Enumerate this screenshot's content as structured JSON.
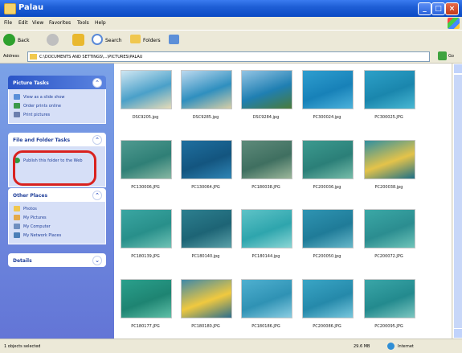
{
  "window": {
    "title": "Palau"
  },
  "menu": [
    "File",
    "Edit",
    "View",
    "Favorites",
    "Tools",
    "Help"
  ],
  "toolbar": {
    "back": "Back",
    "search": "Search",
    "folders": "Folders"
  },
  "address": {
    "label": "Address",
    "path": "C:\\DOCUMENTS AND SETTINGS\\...\\PICTURES\\PALAU",
    "go": "Go"
  },
  "sidebar": {
    "picture_tasks": {
      "title": "Picture Tasks",
      "items": [
        "View as a slide show",
        "Order prints online",
        "Print pictures"
      ]
    },
    "file_folder_tasks": {
      "title": "File and Folder Tasks",
      "items": [
        "Publish this folder to the Web"
      ]
    },
    "other_places": {
      "title": "Other Places",
      "items": [
        "Photos",
        "My Pictures",
        "My Computer",
        "My Network Places"
      ]
    },
    "details": {
      "title": "Details"
    }
  },
  "files": [
    {
      "name": "DSC9205.jpg",
      "colors": [
        "#cfe6f2",
        "#4aa0c9",
        "#e7dcb8"
      ]
    },
    {
      "name": "DSC9285.jpg",
      "colors": [
        "#bcd9ef",
        "#2f8fbf",
        "#d8cfa7"
      ]
    },
    {
      "name": "DSC9284.jpg",
      "colors": [
        "#93c4e4",
        "#1f7fb2",
        "#4a7b3a"
      ]
    },
    {
      "name": "PC300024.jpg",
      "colors": [
        "#2f9ecf",
        "#1781b8",
        "#4cb2db"
      ]
    },
    {
      "name": "PC300025.JPG",
      "colors": [
        "#2da0c8",
        "#1a86ad",
        "#49b8d3"
      ]
    },
    {
      "name": "PC130006.JPG",
      "colors": [
        "#4f9a90",
        "#2f7f76",
        "#87b7a3"
      ]
    },
    {
      "name": "PC130064.JPG",
      "colors": [
        "#1f6f9f",
        "#13557f",
        "#2f85b5"
      ]
    },
    {
      "name": "PC180038.JPG",
      "colors": [
        "#5e8a7a",
        "#3f6f60",
        "#9cb79b"
      ]
    },
    {
      "name": "PC200036.jpg",
      "colors": [
        "#3c9a8f",
        "#2b7f78",
        "#77bca9"
      ]
    },
    {
      "name": "PC200038.jpg",
      "colors": [
        "#2f8fa0",
        "#e4c34a",
        "#1c6f86"
      ]
    },
    {
      "name": "PC180139.JPG",
      "colors": [
        "#3aa6a2",
        "#288f8a",
        "#6fc2b5"
      ]
    },
    {
      "name": "PC180140.jpg",
      "colors": [
        "#2d7f8f",
        "#1d6475",
        "#5aa0a8"
      ]
    },
    {
      "name": "PC180144.jpg",
      "colors": [
        "#5ec3c7",
        "#2ea5ad",
        "#8ad6d5"
      ]
    },
    {
      "name": "PC200050.jpg",
      "colors": [
        "#2f94b2",
        "#1f7b98",
        "#67b7c9"
      ]
    },
    {
      "name": "PC200072.JPG",
      "colors": [
        "#3ba8a6",
        "#2b8d90",
        "#6ec4b9"
      ]
    },
    {
      "name": "PC180177.JPG",
      "colors": [
        "#2aa08c",
        "#1e8472",
        "#5fbfa7"
      ]
    },
    {
      "name": "PC180180.JPG",
      "colors": [
        "#3f88a8",
        "#f0c93f",
        "#2b6d8c"
      ]
    },
    {
      "name": "PC180186.JPG",
      "colors": [
        "#4fb0d0",
        "#2f92b4",
        "#8acde2"
      ]
    },
    {
      "name": "PC200086.JPG",
      "colors": [
        "#3aa5c5",
        "#2589aa",
        "#78c7dd"
      ]
    },
    {
      "name": "PC200095.JPG",
      "colors": [
        "#3aa6a8",
        "#238a8e",
        "#7cc6c0"
      ]
    }
  ],
  "status": {
    "left": "1 objects selected",
    "size": "29.6 MB",
    "zone": "Internet"
  }
}
